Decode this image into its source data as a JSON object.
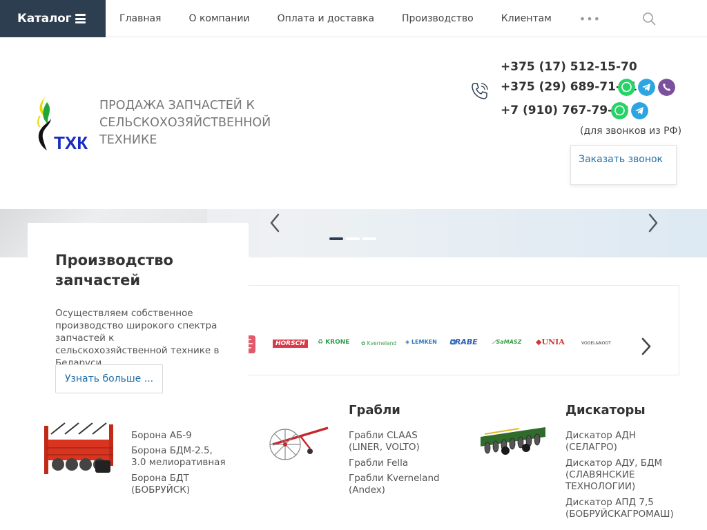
{
  "nav": {
    "catalog_label": "Каталог",
    "items": [
      {
        "label": "Главная"
      },
      {
        "label": "О компании"
      },
      {
        "label": "Оплата и доставка"
      },
      {
        "label": "Производство"
      },
      {
        "label": "Клиентам"
      }
    ],
    "more_label": "•••"
  },
  "header": {
    "logo_text": "ТХК",
    "tagline": "ПРОДАЖА ЗАПЧАСТЕЙ К СЕЛЬСКОХОЗЯЙСТВЕННОЙ ТЕХНИКЕ",
    "phones": [
      "+375 (17) 512-15-70",
      "+375 (29) 689-71-31",
      "+7 (910) 767-79-83"
    ],
    "phone_note": "(для звонков из РФ)",
    "callback_label": "Заказать звонок"
  },
  "colors": {
    "dark": "#2d3e50",
    "link": "#1f6fa8",
    "whatsapp": "#25d366",
    "telegram": "#2ca5e0",
    "viber": "#7b519d"
  },
  "promo": {
    "title": "Производство запчастей",
    "text": "Осуществляем собственное производство широкого спектра запчастей к сельскохозяйственной технике в Беларуси.",
    "button": "Узнать больше ..."
  },
  "slider": {
    "slides": 3,
    "active": 1
  },
  "brands": [
    "HORSCH",
    "KRONE",
    "Kverneland",
    "LEMKEN",
    "RABE",
    "SaMASZ",
    "UNIA",
    "VOGEL&NOOT"
  ],
  "categories": [
    {
      "title": "",
      "links": [
        "Борона АБ-9",
        "Борона БДМ-2.5, 3.0 мелиоративная",
        "Борона БДТ (БОБРУЙСК)"
      ]
    },
    {
      "title": "Грабли",
      "links": [
        "Грабли CLAAS (LINER, VOLTO)",
        "Грабли Fella",
        "Грабли Kverneland (Andex)"
      ]
    },
    {
      "title": "Дискаторы",
      "links": [
        "Дискатор АДН (СЕЛАГРО)",
        "Дискатор АДУ, БДМ (СЛАВЯНСКИЕ ТЕХНОЛОГИИ)",
        "Дискатор АПД 7,5 (БОБРУЙСКАГРОМАШ)"
      ]
    }
  ]
}
